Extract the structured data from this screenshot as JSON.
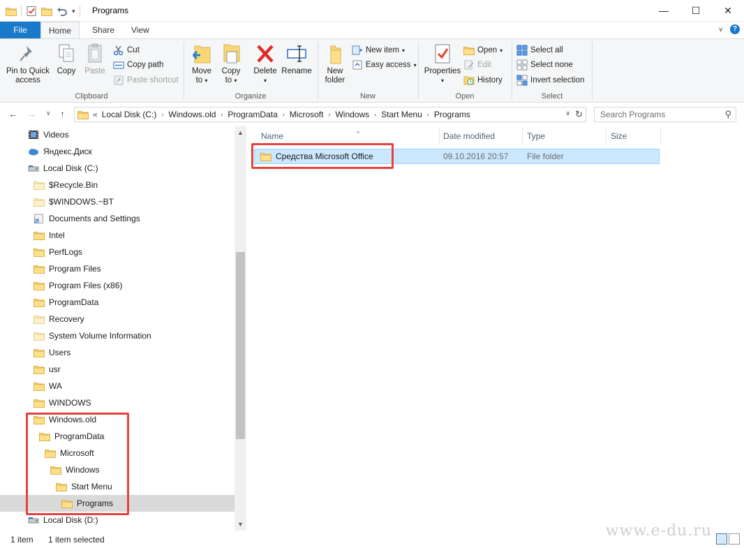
{
  "window": {
    "title": "Programs",
    "controls": {
      "minimize": "—",
      "maximize": "☐",
      "close": "✕"
    }
  },
  "ribbon_tabs": [
    {
      "label": "File"
    },
    {
      "label": "Home"
    },
    {
      "label": "Share"
    },
    {
      "label": "View"
    }
  ],
  "ribbon": {
    "clipboard": {
      "label": "Clipboard",
      "pin": "Pin to Quick access",
      "pin_line1": "Pin to Quick",
      "pin_line2": "access",
      "copy": "Copy",
      "paste": "Paste",
      "cut": "Cut",
      "copy_path": "Copy path",
      "paste_shortcut": "Paste shortcut"
    },
    "organize": {
      "label": "Organize",
      "move_to_line1": "Move",
      "move_to_line2": "to",
      "copy_to_line1": "Copy",
      "copy_to_line2": "to",
      "delete": "Delete",
      "rename": "Rename"
    },
    "new": {
      "label": "New",
      "new_folder_line1": "New",
      "new_folder_line2": "folder",
      "new_item": "New item",
      "easy_access": "Easy access"
    },
    "open": {
      "label": "Open",
      "properties": "Properties",
      "open": "Open",
      "edit": "Edit",
      "history": "History"
    },
    "select": {
      "label": "Select",
      "select_all": "Select all",
      "select_none": "Select none",
      "invert": "Invert selection"
    }
  },
  "address": {
    "overflow": "«",
    "crumbs": [
      "Local Disk (C:)",
      "Windows.old",
      "ProgramData",
      "Microsoft",
      "Windows",
      "Start Menu",
      "Programs"
    ]
  },
  "search": {
    "placeholder": "Search Programs"
  },
  "nav_tree": [
    {
      "label": "Videos",
      "icon": "videos-icon"
    },
    {
      "label": "Яндекс.Диск",
      "icon": "cloud-icon"
    },
    {
      "label": "Local Disk (C:)",
      "icon": "drive-icon"
    },
    {
      "label": "$Recycle.Bin",
      "icon": "folder-icon"
    },
    {
      "label": "$WINDOWS.~BT",
      "icon": "folder-icon"
    },
    {
      "label": "Documents and Settings",
      "icon": "shortcut-folder-icon"
    },
    {
      "label": "Intel",
      "icon": "folder-icon"
    },
    {
      "label": "PerfLogs",
      "icon": "folder-icon"
    },
    {
      "label": "Program Files",
      "icon": "folder-icon"
    },
    {
      "label": "Program Files (x86)",
      "icon": "folder-icon"
    },
    {
      "label": "ProgramData",
      "icon": "folder-icon"
    },
    {
      "label": "Recovery",
      "icon": "folder-icon"
    },
    {
      "label": "System Volume Information",
      "icon": "folder-icon"
    },
    {
      "label": "Users",
      "icon": "folder-icon"
    },
    {
      "label": "usr",
      "icon": "folder-icon"
    },
    {
      "label": "WA",
      "icon": "folder-icon"
    },
    {
      "label": "WINDOWS",
      "icon": "folder-icon"
    },
    {
      "label": "Windows.old",
      "icon": "folder-icon"
    },
    {
      "label": "ProgramData",
      "icon": "folder-icon"
    },
    {
      "label": "Microsoft",
      "icon": "folder-icon"
    },
    {
      "label": "Windows",
      "icon": "folder-icon"
    },
    {
      "label": "Start Menu",
      "icon": "folder-icon"
    },
    {
      "label": "Programs",
      "icon": "folder-icon",
      "selected": true
    },
    {
      "label": "Local Disk (D:)",
      "icon": "drive-icon"
    }
  ],
  "columns": {
    "name": "Name",
    "date": "Date modified",
    "type": "Type",
    "size": "Size"
  },
  "files": [
    {
      "name": "Средства Microsoft Office",
      "date": "09.10.2016 20:57",
      "type": "File folder",
      "size": ""
    }
  ],
  "status": {
    "count": "1 item",
    "selected": "1 item selected"
  },
  "watermark": "www.e-du.ru",
  "colors": {
    "accent": "#1979ca",
    "highlight": "#e5413d",
    "selection": "#cce8ff",
    "folder": "#ffd966"
  }
}
